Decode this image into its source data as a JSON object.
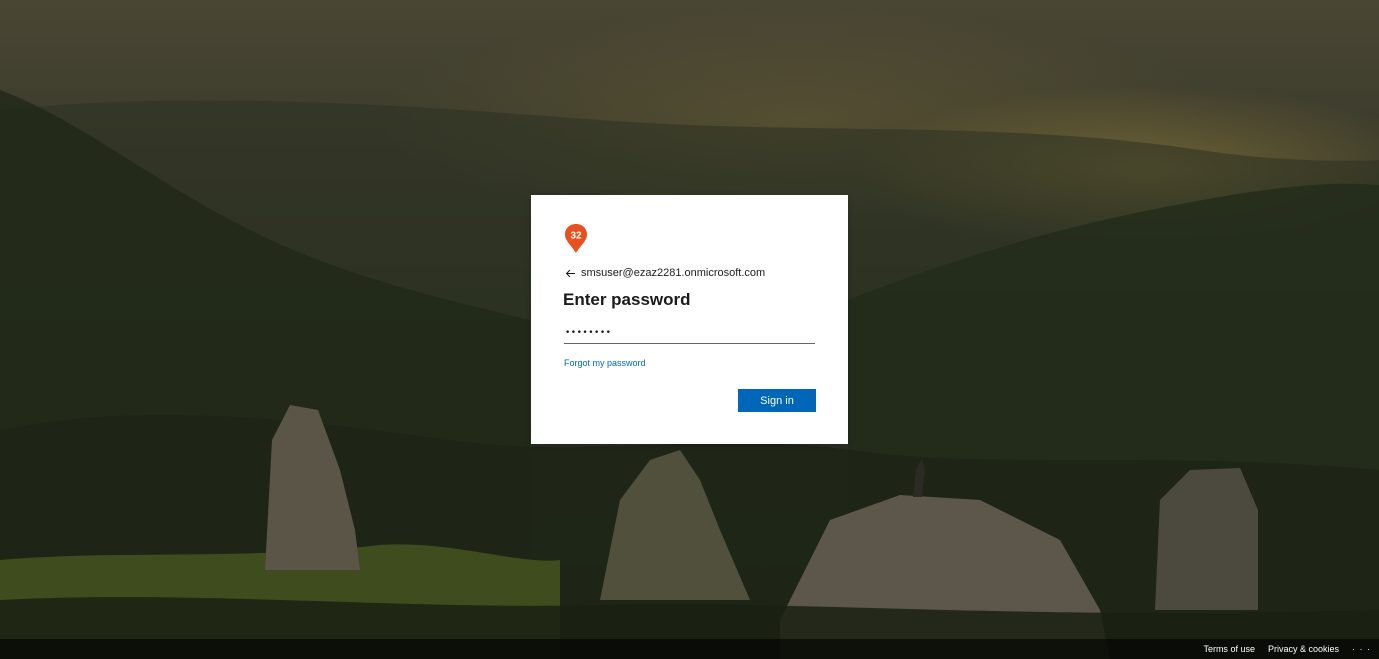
{
  "login": {
    "logo_badge": "32",
    "account_email": "smsuser@ezaz2281.onmicrosoft.com",
    "title": "Enter password",
    "password_masked": "••••••••",
    "forgot_link": "Forgot my password",
    "signin_button": "Sign in"
  },
  "footer": {
    "terms": "Terms of use",
    "privacy": "Privacy & cookies",
    "more": "· · ·"
  },
  "colors": {
    "accent": "#0067b8",
    "logo_orange": "#e8501f"
  },
  "icons": {
    "back": "arrow-left-icon",
    "logo": "map-pin-icon"
  }
}
